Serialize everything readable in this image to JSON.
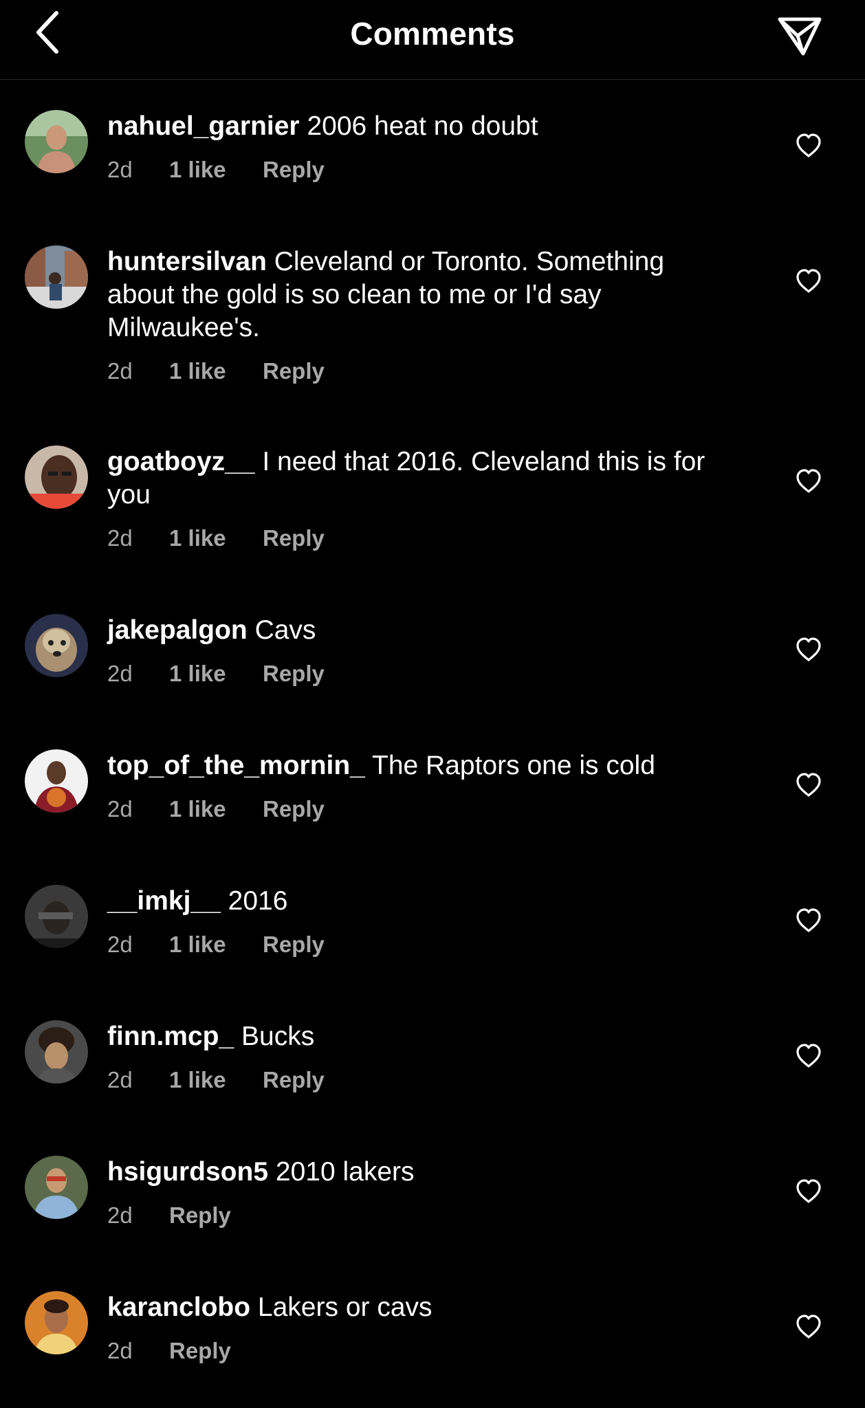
{
  "header": {
    "title": "Comments",
    "back_icon": "chevron-left-icon",
    "send_icon": "paper-plane-icon"
  },
  "comments": [
    {
      "username": "nahuel_garnier",
      "text": "2006 heat no doubt",
      "time": "2d",
      "likes": "1 like",
      "reply": "Reply"
    },
    {
      "username": "huntersilvan",
      "text": "Cleveland or Toronto. Something about the gold is so clean to me or I'd say Milwaukee's.",
      "time": "2d",
      "likes": "1 like",
      "reply": "Reply"
    },
    {
      "username": "goatboyz__",
      "text": "I need that 2016. Cleveland this is for you",
      "time": "2d",
      "likes": "1 like",
      "reply": "Reply"
    },
    {
      "username": "jakepalgon",
      "text": "Cavs",
      "time": "2d",
      "likes": "1 like",
      "reply": "Reply"
    },
    {
      "username": "top_of_the_mornin_",
      "text": "The Raptors one is cold",
      "time": "2d",
      "likes": "1 like",
      "reply": "Reply"
    },
    {
      "username": "__imkj__",
      "text": "2016",
      "time": "2d",
      "likes": "1 like",
      "reply": "Reply"
    },
    {
      "username": "finn.mcp_",
      "text": "Bucks",
      "time": "2d",
      "likes": "1 like",
      "reply": "Reply"
    },
    {
      "username": "hsigurdson5",
      "text": "2010 lakers",
      "time": "2d",
      "likes": "",
      "reply": "Reply"
    },
    {
      "username": "karanclobo",
      "text": "Lakers or cavs",
      "time": "2d",
      "likes": "",
      "reply": "Reply"
    }
  ],
  "colors": {
    "background": "#000000",
    "text": "#ffffff",
    "secondary_text": "#a8a8a8",
    "divider": "#262626"
  }
}
